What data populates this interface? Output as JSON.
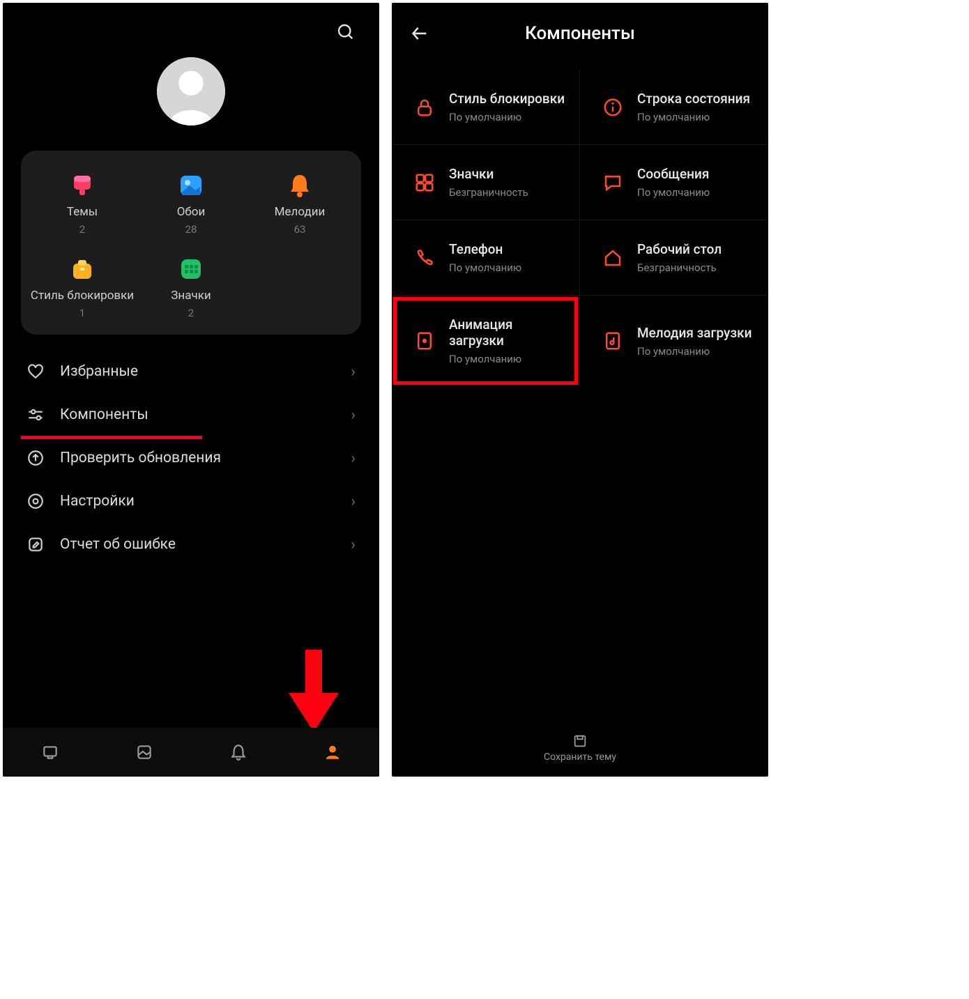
{
  "left": {
    "card": {
      "tiles": [
        {
          "label": "Темы",
          "count": "2"
        },
        {
          "label": "Обои",
          "count": "28"
        },
        {
          "label": "Мелодии",
          "count": "63"
        },
        {
          "label": "Стиль блокировки",
          "count": "1"
        },
        {
          "label": "Значки",
          "count": "2"
        }
      ]
    },
    "menu": [
      {
        "label": "Избранные"
      },
      {
        "label": "Компоненты"
      },
      {
        "label": "Проверить обновления"
      },
      {
        "label": "Настройки"
      },
      {
        "label": "Отчет об ошибке"
      }
    ]
  },
  "right": {
    "title": "Компоненты",
    "components": [
      {
        "title": "Стиль блокировки",
        "sub": "По умолчанию"
      },
      {
        "title": "Строка состояния",
        "sub": "По умолчанию"
      },
      {
        "title": "Значки",
        "sub": "Безграничность"
      },
      {
        "title": "Сообщения",
        "sub": "По умолчанию"
      },
      {
        "title": "Телефон",
        "sub": "По умолчанию"
      },
      {
        "title": "Рабочий стол",
        "sub": "Безграничность"
      },
      {
        "title": "Анимация загрузки",
        "sub": "По умолчанию"
      },
      {
        "title": "Мелодия загрузки",
        "sub": "По умолчанию"
      }
    ],
    "save_label": "Сохранить тему"
  }
}
